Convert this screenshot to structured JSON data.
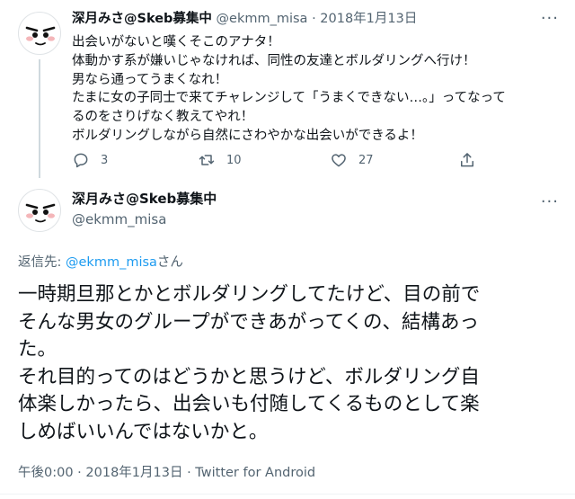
{
  "parent_tweet": {
    "display_name": "深月みさ@Skeb募集中",
    "handle": "@ekmm_misa",
    "separator": "·",
    "date": "2018年1月13日",
    "text_lines": [
      "出会いがないと嘆くそこのアナタ！",
      "体動かす系が嫌いじゃなければ、同性の友達とボルダリングへ行け！",
      "男なら通ってうまくなれ！",
      "たまに女の子同士で来てチャレンジして「うまくできない…。」ってなって",
      "るのをさりげなく教えてやれ！",
      "ボルダリングしながら自然にさわやかな出会いができるよ！"
    ],
    "actions": {
      "reply_count": "3",
      "retweet_count": "10",
      "like_count": "27"
    },
    "icons": [
      "avatar",
      "more-icon",
      "reply-icon",
      "retweet-icon",
      "like-icon",
      "share-icon"
    ]
  },
  "main_tweet": {
    "display_name": "深月みさ@Skeb募集中",
    "handle": "@ekmm_misa",
    "reply_prefix": "返信先: ",
    "reply_handle": "@ekmm_misa",
    "reply_suffix": "さん",
    "text_lines": [
      "一時期旦那とかとボルダリングしてたけど、目の前で",
      "そんな男女のグループができあがってくの、結構あっ",
      "た。",
      "それ目的ってのはどうかと思うけど、ボルダリング自",
      "体楽しかったら、出会いも付随してくるものとして楽",
      "しめばいいんではないかと。"
    ],
    "time": "午後0:00",
    "date": "2018年1月13日",
    "separator": "·",
    "source": "Twitter for Android"
  },
  "colors": {
    "text": "#0f1419",
    "muted": "#536471",
    "link": "#1d9bf0",
    "thread_line": "#cfd9de"
  }
}
